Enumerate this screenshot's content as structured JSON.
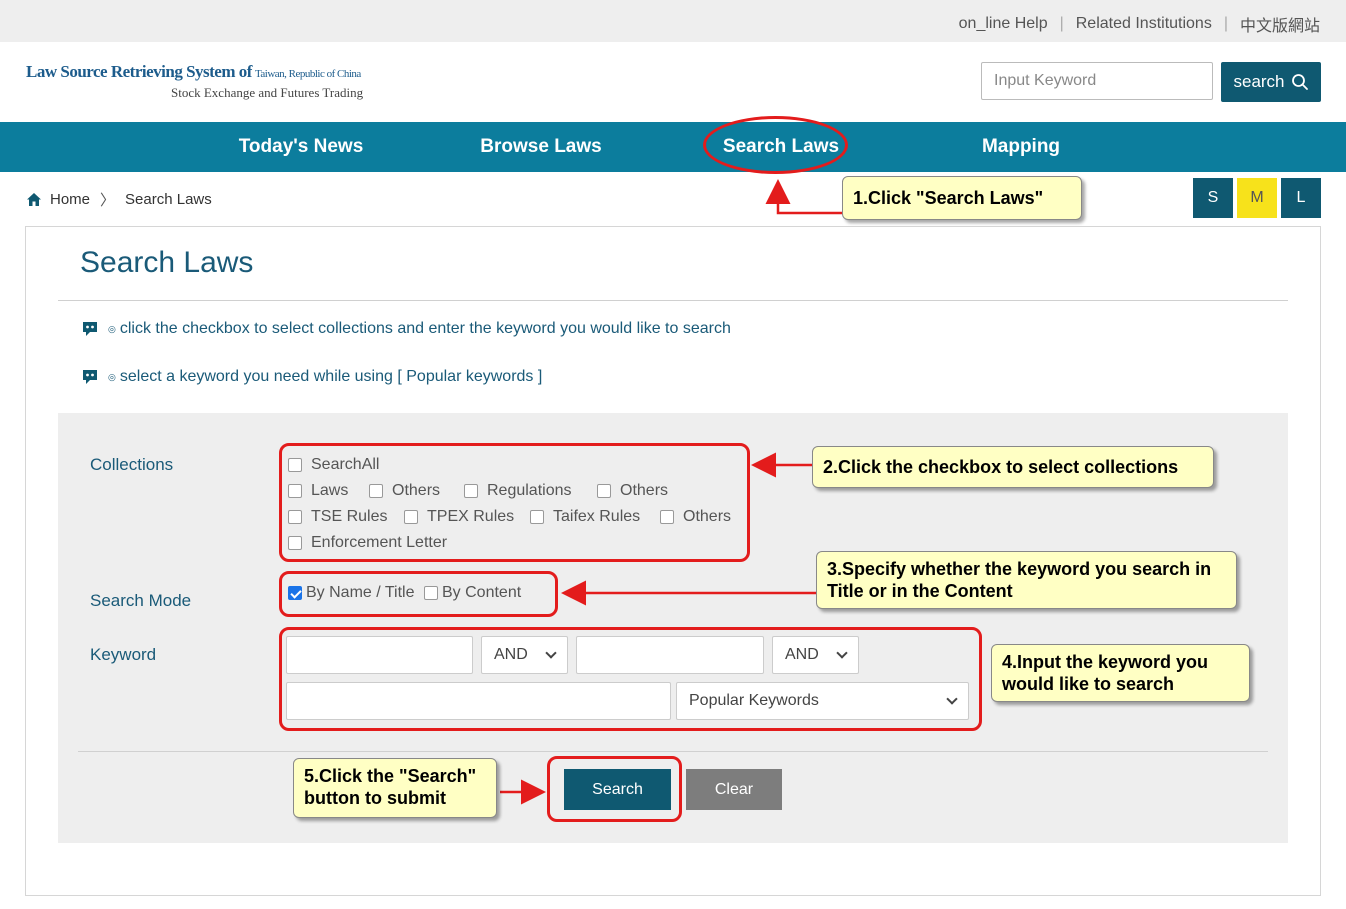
{
  "topbar": {
    "links": [
      "on_line Help",
      "Related Institutions",
      "中文版網站"
    ]
  },
  "header": {
    "logo_line1": "Law Source Retrieving System of",
    "logo_line1_small": "Taiwan, Republic of China",
    "logo_line2": "Stock Exchange and Futures Trading",
    "search_placeholder": "Input Keyword",
    "search_button": "search"
  },
  "nav": {
    "items": [
      "Today's News",
      "Browse Laws",
      "Search Laws",
      "Mapping"
    ]
  },
  "breadcrumb": {
    "home": "Home",
    "current": "Search Laws"
  },
  "font_sizes": [
    "S",
    "M",
    "L"
  ],
  "page": {
    "title": "Search Laws",
    "tips": [
      "click the checkbox to select collections and enter the keyword you would like to search",
      "select a keyword you need while using [ Popular keywords ]"
    ]
  },
  "form": {
    "collections_label": "Collections",
    "collections": {
      "all": "SearchAll",
      "row1": [
        "Laws",
        "Others",
        "Regulations",
        "Others"
      ],
      "row2": [
        "TSE Rules",
        "TPEX Rules",
        "Taifex Rules",
        "Others"
      ],
      "row3": [
        "Enforcement Letter"
      ]
    },
    "search_mode_label": "Search Mode",
    "search_mode": {
      "by_name": "By Name / Title",
      "by_content": "By Content",
      "by_name_checked": true,
      "by_content_checked": false
    },
    "keyword_label": "Keyword",
    "operator1": "AND",
    "operator2": "AND",
    "popular_keywords": "Popular Keywords",
    "search_button": "Search",
    "clear_button": "Clear"
  },
  "annotations": {
    "step1": "1.Click \"Search Laws\"",
    "step2": "2.Click the checkbox to select collections",
    "step3": "3.Specify whether the keyword you search in Title or in the Content",
    "step4": "4.Input the keyword you would like to search",
    "step5": "5.Click the \"Search\" button to submit"
  },
  "colors": {
    "nav": "#0c7d9d",
    "dark_teal": "#0f5971",
    "size_active": "#f7e21b",
    "annotation_red": "#e31c1c",
    "callout_bg": "#ffffc4"
  }
}
